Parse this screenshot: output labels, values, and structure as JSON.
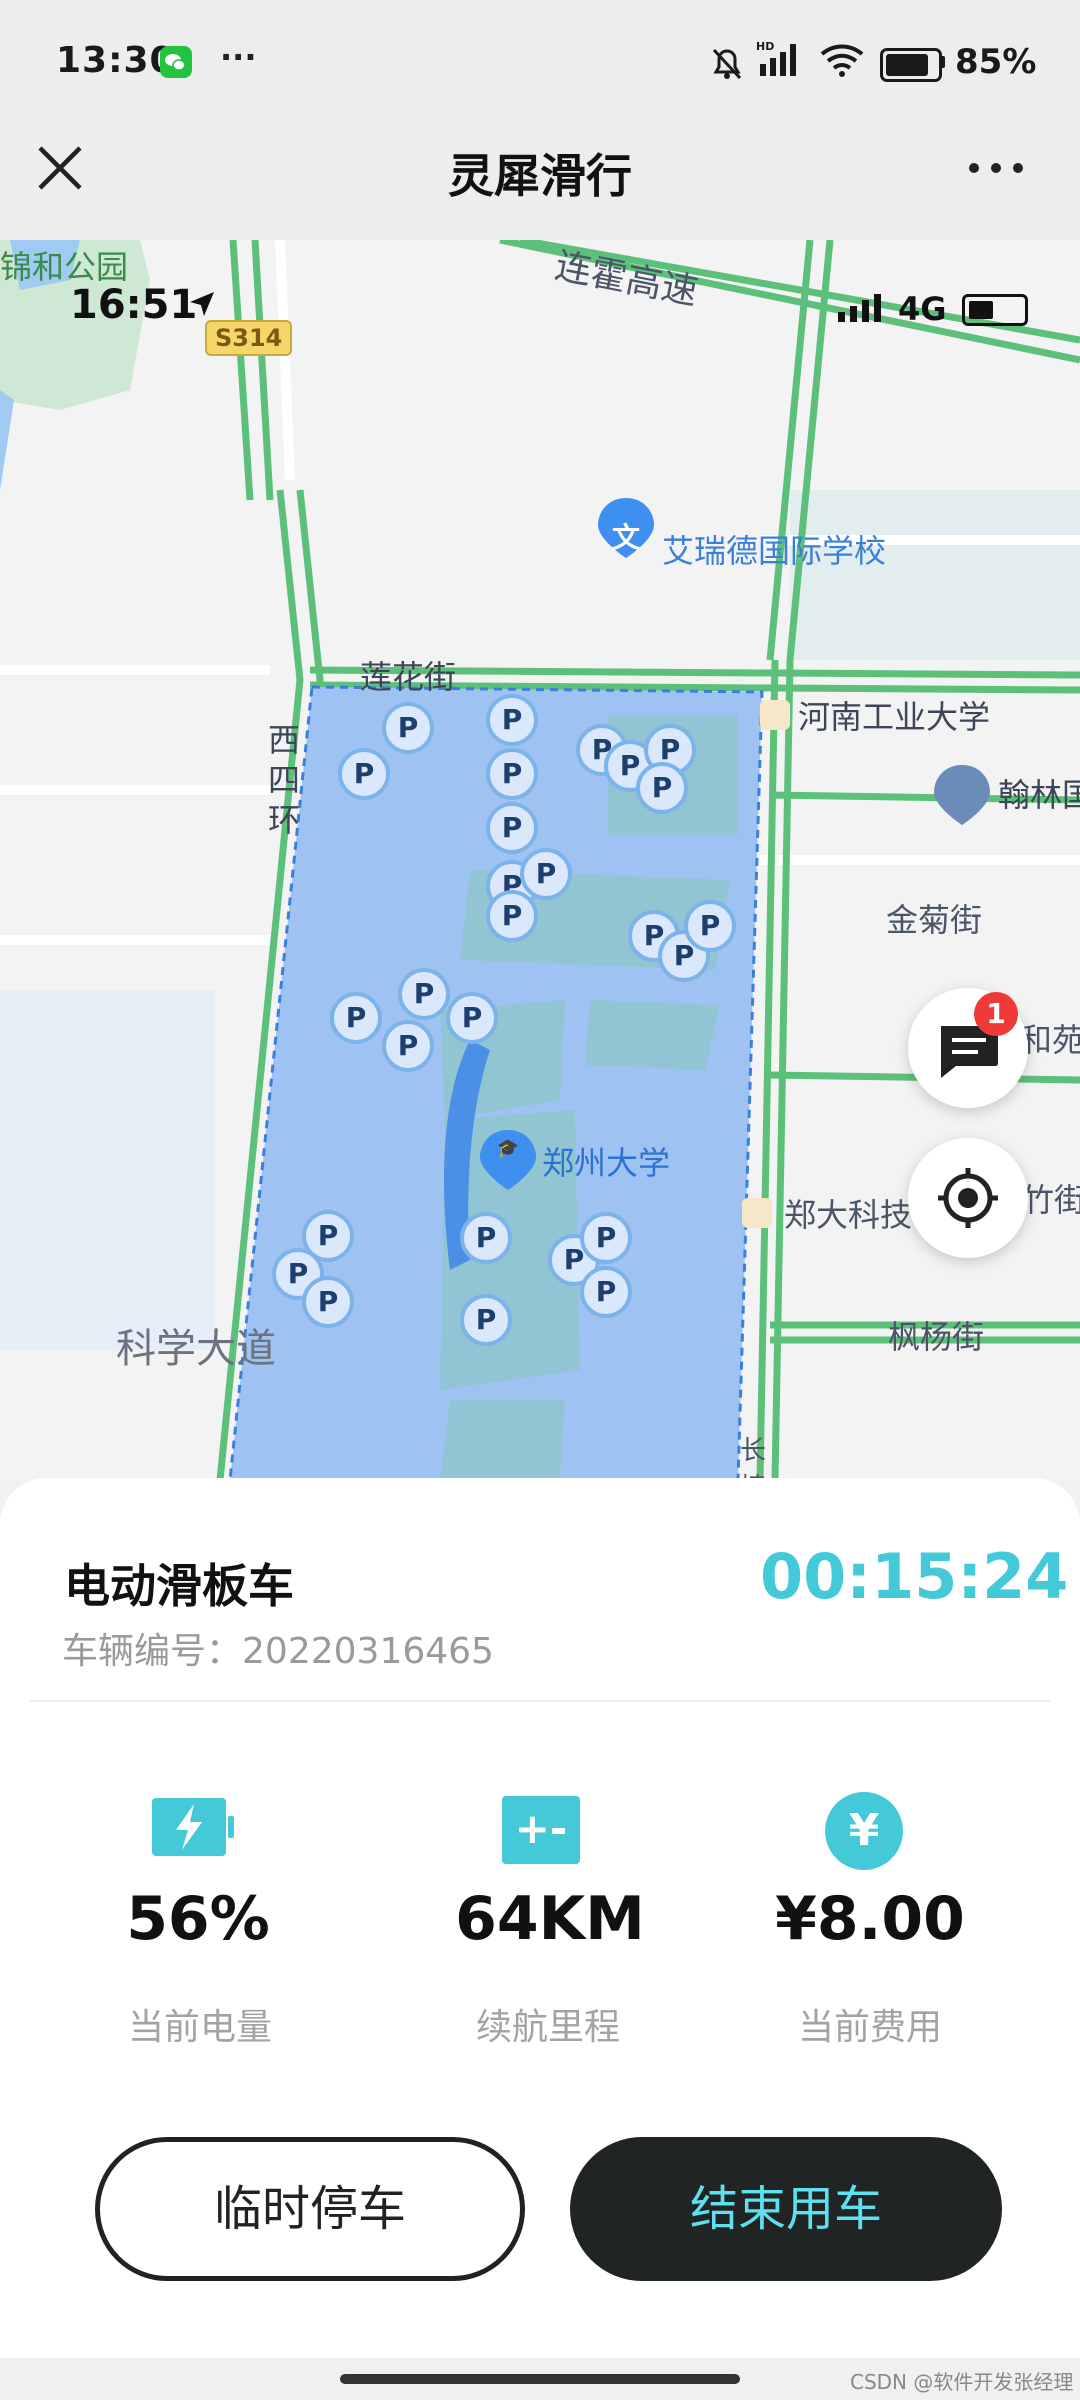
{
  "status_bar": {
    "time": "13:30",
    "battery": "85%",
    "more": "···",
    "icons": [
      "wechat-icon",
      "mute-bell-icon",
      "signal-icon",
      "wifi-icon",
      "battery-icon"
    ]
  },
  "title_bar": {
    "close_icon": "close-icon",
    "title": "灵犀滑行",
    "more_icon": "more-icon"
  },
  "map": {
    "inner_status_time": "16:51",
    "inner_status_net": "4G",
    "road_badge": "S314",
    "labels": {
      "park": "锦和公园",
      "highway": "连霍高速",
      "school": "艾瑞德国际学校",
      "lianhua": "莲花街",
      "xisihuan": "西四环",
      "henan_univ": "河南工业大学",
      "hanlin": "翰林国",
      "jinju": "金菊街",
      "hey": "和苑",
      "zhumeng": "竹街",
      "zzu": "郑州大学",
      "zhengda_tech": "郑大科技",
      "science_ave": "科学大道",
      "fengyang": "枫杨街",
      "chang": "长椿"
    },
    "parking_label": "P",
    "poi_icon_text": "文",
    "message_badge": "1",
    "accent": "#5b9cec"
  },
  "trip": {
    "vehicle_type": "电动滑板车",
    "vehicle_id_label": "车辆编号：",
    "vehicle_id": "20220316465",
    "timer": "00:15:24",
    "accent": "#44c9d8"
  },
  "stats": [
    {
      "icon": "battery-charging-icon",
      "value": "56%",
      "label": "当前电量"
    },
    {
      "icon": "range-icon",
      "icon_text": "+-",
      "value": "64KM",
      "label": "续航里程"
    },
    {
      "icon": "yuan-icon",
      "icon_text": "¥",
      "value": "¥8.00",
      "label": "当前费用"
    }
  ],
  "actions": {
    "temp_park": "临时停车",
    "end_ride": "结束用车"
  },
  "watermark": "CSDN @软件开发张经理"
}
